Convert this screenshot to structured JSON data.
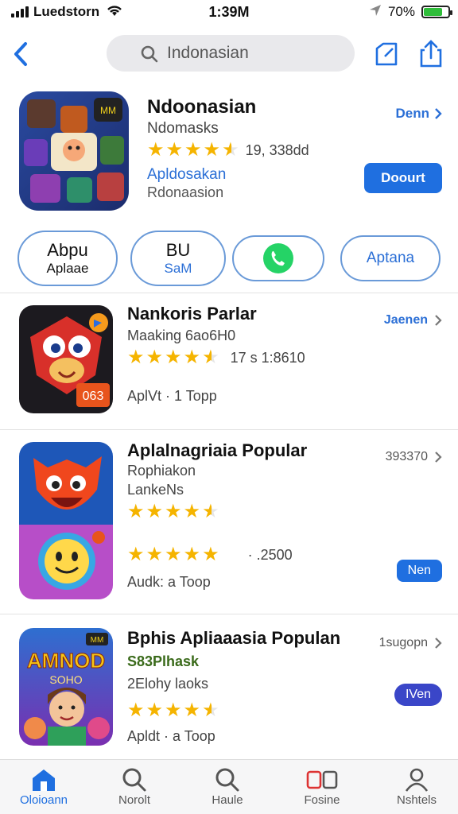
{
  "status": {
    "carrier": "Luedstorn",
    "time": "1:39M",
    "battery": "70%"
  },
  "search": {
    "query": "Indonasian"
  },
  "featured": {
    "title": "Ndoonasian",
    "developer": "Ndomasks",
    "rating": 4.5,
    "rating_count": "19, 338dd",
    "link": "Apldosakan",
    "subtitle": "Rdonaasion",
    "top_right": "Denn",
    "button": "Doourt"
  },
  "chips": [
    {
      "line1": "Abpu",
      "line2": "Aplaae"
    },
    {
      "line1": "BU",
      "line2": "SaM"
    },
    {
      "icon": "whatsapp-icon"
    },
    {
      "line1": "Aptana",
      "line2": ""
    }
  ],
  "apps": [
    {
      "name": "Nankoris Parlar",
      "line2": "Maaking 6ao6H0",
      "rating": 4.5,
      "rating_count": "17 s 1:8610",
      "line3": "AplVt · 1 Topp",
      "meta": "Jaenen"
    },
    {
      "name": "Aplalnagriaia Popular",
      "line2": "Rophiakon",
      "line3": "LankeNs",
      "rating": 4.5,
      "meta": "393370",
      "rating2": 5,
      "rating2_count": "· .2500",
      "line4": "Audk: a Toop",
      "button": "Nen"
    },
    {
      "name": "Bphis Apliaaasia Populan",
      "line2": "S83Plhask",
      "line3": "2Elohy laoks",
      "rating": 4.5,
      "meta": "1sugopn",
      "line4": "Apldt · a Toop",
      "button": "IVen"
    }
  ],
  "tabs": [
    {
      "label": "Oloioann",
      "icon": "home-icon",
      "active": true
    },
    {
      "label": "Norolt",
      "icon": "search-icon",
      "active": false
    },
    {
      "label": "Haule",
      "icon": "search-icon",
      "active": false
    },
    {
      "label": "Fosine",
      "icon": "apps-icon",
      "active": false
    },
    {
      "label": "Nshtels",
      "icon": "person-icon",
      "active": false
    }
  ],
  "colors": {
    "accent": "#1f6fe0",
    "star": "#f5b400",
    "whatsapp": "#25d366",
    "pill_dark": "#3a46c8"
  }
}
